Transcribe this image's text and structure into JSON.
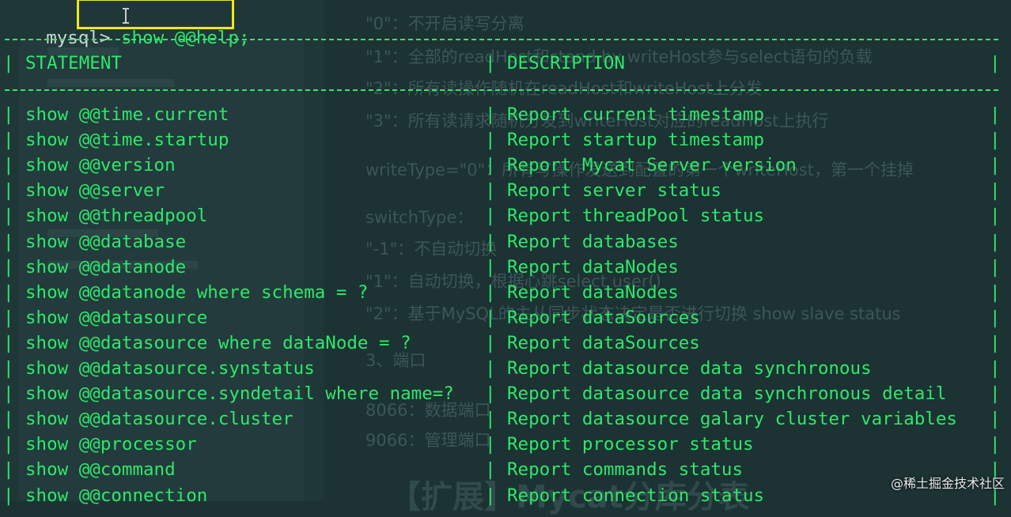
{
  "terminal": {
    "prompt": "mysql>",
    "command": "show @@help;",
    "headers": {
      "statement": "STATEMENT",
      "description": "DESCRIPTION"
    },
    "rows": [
      {
        "statement": "show @@time.current",
        "description": "Report current timestamp"
      },
      {
        "statement": "show @@time.startup",
        "description": "Report startup timestamp"
      },
      {
        "statement": "show @@version",
        "description": "Report Mycat Server version"
      },
      {
        "statement": "show @@server",
        "description": "Report server status"
      },
      {
        "statement": "show @@threadpool",
        "description": "Report threadPool status"
      },
      {
        "statement": "show @@database",
        "description": "Report databases"
      },
      {
        "statement": "show @@datanode",
        "description": "Report dataNodes"
      },
      {
        "statement": "show @@datanode where schema = ?",
        "description": "Report dataNodes"
      },
      {
        "statement": "show @@datasource",
        "description": "Report dataSources"
      },
      {
        "statement": "show @@datasource where dataNode = ?",
        "description": "Report dataSources"
      },
      {
        "statement": "show @@datasource.synstatus",
        "description": "Report datasource data synchronous"
      },
      {
        "statement": "show @@datasource.syndetail where name=?",
        "description": "Report datasource data synchronous detail"
      },
      {
        "statement": "show @@datasource.cluster",
        "description": "Report datasource galary cluster variables"
      },
      {
        "statement": "show @@processor",
        "description": "Report processor status"
      },
      {
        "statement": "show @@command",
        "description": "Report commands status"
      },
      {
        "statement": "show @@connection",
        "description": "Report connection status"
      }
    ]
  },
  "background_doc": {
    "lines": [
      "\"0\"：不开启读写分离",
      "\"1\"：全部的readHost和stand by writeHost参与select语句的负载",
      "\"2\"：所有读操作随机在readHost和writeHost上分发",
      "\"3\"：所有读请求随机分发到writeHost对应的readHost上执行",
      "writeType=\"0\"：所有写操作发送到配置的第一个writeHost，第一个挂掉",
      "switchType：",
      "\"-1\"：不自动切换",
      "\"1\"：自动切换，根据心跳select user()",
      "\"2\"：基于MySQL的主从同步状态决定是否进行切换 show slave status",
      "3、端口",
      "8066：数据端口",
      "9066：管理端口",
      "【扩展】Mycat分库分表"
    ]
  },
  "watermark": "@稀土掘金技术社区",
  "colors": {
    "terminal_text": "#2ee86b",
    "highlight_box": "#f2e51a",
    "background": "#1c3233"
  }
}
